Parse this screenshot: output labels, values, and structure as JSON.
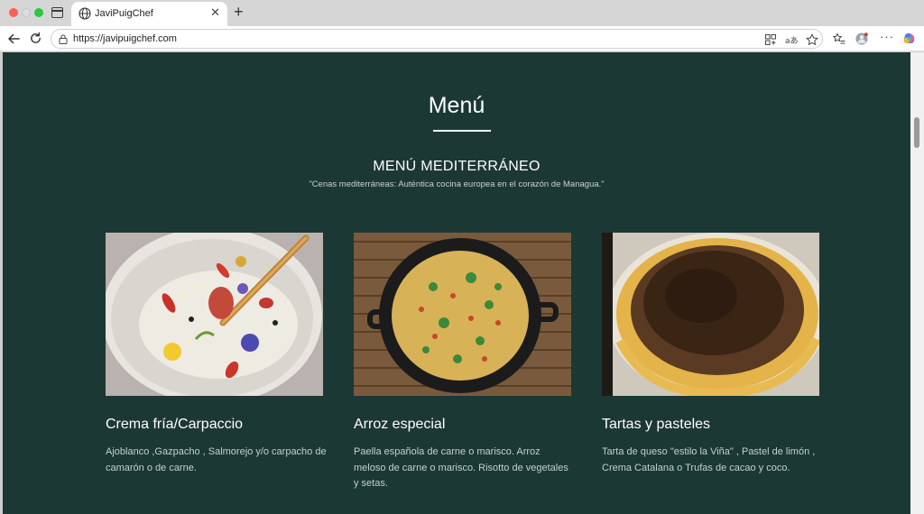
{
  "browser": {
    "tab_title": "JaviPuigChef",
    "url": "https://javipuigchef.com"
  },
  "page": {
    "title": "Menú",
    "section_title": "MENÚ MEDITERRÁNEO",
    "section_subtitle": "\"Cenas mediterráneas: Auténtica cocina europea en el corazón de Managua.\"",
    "dishes": [
      {
        "title": "Crema fría/Carpaccio",
        "description": "Ajoblanco ,Gazpacho , Salmorejo y/o carpacho de camarón o de carne."
      },
      {
        "title": "Arroz especial",
        "description": "Paella española de carne o marisco. Arroz meloso de carne o marisco. Risotto de vegetales y setas."
      },
      {
        "title": "Tartas y pasteles",
        "description": "Tarta de queso \"estilo la Viña\" , Pastel de limón , Crema Catalana o Trufas de cacao y coco."
      }
    ]
  },
  "colors": {
    "page_background": "#1c3834",
    "muted_text": "#c4d0cd"
  }
}
